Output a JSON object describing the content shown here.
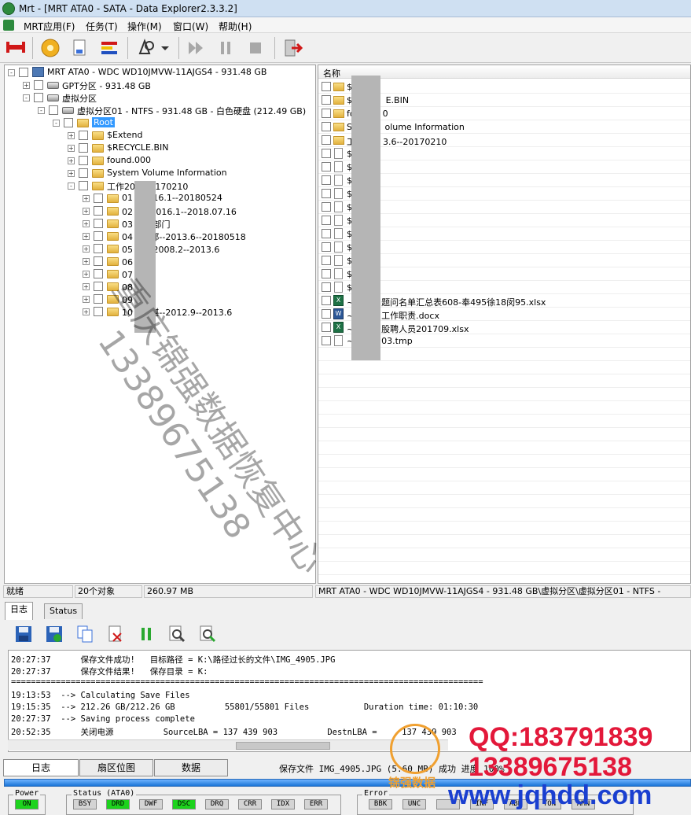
{
  "window": {
    "title": "Mrt - [MRT ATA0 - SATA - Data Explorer2.3.3.2]"
  },
  "menu": [
    "MRT应用(F)",
    "任务(T)",
    "操作(M)",
    "窗口(W)",
    "帮助(H)"
  ],
  "tree": [
    {
      "label": "MRT ATA0 - WDC WD10JMVW-11AJGS4 - 931.48 GB",
      "level": 0,
      "icon": "computer-icon",
      "expander": "-"
    },
    {
      "label": "GPT分区 - 931.48 GB",
      "level": 1,
      "icon": "disk-icon",
      "expander": "+"
    },
    {
      "label": "虚拟分区",
      "level": 1,
      "icon": "disk-icon",
      "expander": "-"
    },
    {
      "label": "虚拟分区01 - NTFS - 931.48 GB - 白色硬盘 (212.49 GB)",
      "level": 2,
      "icon": "disk-icon",
      "expander": "-"
    },
    {
      "label": "Root",
      "level": 3,
      "icon": "folder-icon",
      "expander": "-",
      "selected": true
    },
    {
      "label": "$Extend",
      "level": 4,
      "icon": "folder-icon",
      "expander": "+"
    },
    {
      "label": "$RECYCLE.BIN",
      "level": 4,
      "icon": "folder-icon",
      "expander": "+"
    },
    {
      "label": "found.000",
      "level": 4,
      "icon": "folder-icon",
      "expander": "+"
    },
    {
      "label": "System Volume Information",
      "level": 4,
      "icon": "folder-icon",
      "expander": "+"
    },
    {
      "label": "工作20     --20170210",
      "level": 4,
      "icon": "folder-icon",
      "expander": "-"
    },
    {
      "label": "01         --2016.1--20180524",
      "level": 5,
      "icon": "folder-icon",
      "expander": "+"
    },
    {
      "label": "02         会--2016.1--2018.07.16",
      "level": 5,
      "icon": "folder-icon",
      "expander": "+"
    },
    {
      "label": "03         职能部门",
      "level": 5,
      "icon": "folder-icon",
      "expander": "+"
    },
    {
      "label": "04         部--邵--2013.6--20180518",
      "level": 5,
      "icon": "folder-icon",
      "expander": "+"
    },
    {
      "label": "05         工作2008.2--2013.6",
      "level": 5,
      "icon": "folder-icon",
      "expander": "+"
    },
    {
      "label": "06         工作",
      "level": 5,
      "icon": "folder-icon",
      "expander": "+"
    },
    {
      "label": "07         工作",
      "level": 5,
      "icon": "folder-icon",
      "expander": "+"
    },
    {
      "label": "08         证书",
      "level": 5,
      "icon": "folder-icon",
      "expander": "+"
    },
    {
      "label": "09         申报",
      "level": 5,
      "icon": "folder-icon",
      "expander": "+"
    },
    {
      "label": "10         部--谌--2012.9--2013.6",
      "level": 5,
      "icon": "folder-icon",
      "expander": "+"
    }
  ],
  "files": {
    "header": "名称",
    "rows": [
      {
        "name": "$",
        "icon": "folder"
      },
      {
        "name": "$R          E.BIN",
        "icon": "folder"
      },
      {
        "name": "fo          0",
        "icon": "folder"
      },
      {
        "name": "Sy          olume Information",
        "icon": "folder"
      },
      {
        "name": "工          3.6--20170210",
        "icon": "folder"
      },
      {
        "name": "$A",
        "icon": "file"
      },
      {
        "name": "$B",
        "icon": "file"
      },
      {
        "name": "$B",
        "icon": "file"
      },
      {
        "name": "$E",
        "icon": "file"
      },
      {
        "name": "$L",
        "icon": "file"
      },
      {
        "name": "$N",
        "icon": "file"
      },
      {
        "name": "$N",
        "icon": "file"
      },
      {
        "name": "$S",
        "icon": "file"
      },
      {
        "name": "$U",
        "icon": "file"
      },
      {
        "name": "$V",
        "icon": "file"
      },
      {
        "name": "$V",
        "icon": "file"
      },
      {
        "name": "~          题问名单汇总表608-奉495徐18闵95.xlsx",
        "icon": "xls"
      },
      {
        "name": "~          工作职责.docx",
        "icon": "doc"
      },
      {
        "name": "~          股聘人员201709.xlsx",
        "icon": "xls"
      },
      {
        "name": "~          03.tmp",
        "icon": "file"
      }
    ]
  },
  "status": {
    "state": "就绪",
    "count": "20个对象",
    "size": "260.97 MB",
    "path": "MRT ATA0 - WDC WD10JMVW-11AJGS4 - 931.48 GB\\虚拟分区\\虚拟分区01 - NTFS -"
  },
  "log_tabs": [
    "日志",
    "Status"
  ],
  "log_lines": [
    "20:27:37      保存文件成功!   目标路径 = K:\\路径过长的文件\\IMG_4905.JPG",
    "20:27:37      保存文件结果!   保存目录 = K:",
    "===============================================================================================",
    "19:13:53  --> Calculating Save Files",
    "19:15:35  --> 212.26 GB/212.26 GB          55801/55801 Files           Duration time: 01:10:30",
    "20:27:37  --> Saving process complete",
    "20:52:35      关闭电源          SourceLBA = 137 439 903          DestnLBA =     137 439 903"
  ],
  "bottom_tabs": [
    "日志",
    "扇区位图",
    "数据"
  ],
  "save_status": "保存文件 IMG_4905.JPG (5.60 MB) 成功  进度 100%",
  "footer": {
    "power_title": "Power",
    "power": [
      {
        "label": "ON",
        "on": true
      }
    ],
    "status_title": "Status (ATA0)",
    "status_leds": [
      {
        "label": "BSY",
        "on": false
      },
      {
        "label": "DRD",
        "on": true
      },
      {
        "label": "DWF",
        "on": false
      },
      {
        "label": "DSC",
        "on": true
      },
      {
        "label": "DRQ",
        "on": false
      },
      {
        "label": "CRR",
        "on": false
      },
      {
        "label": "IDX",
        "on": false
      },
      {
        "label": "ERR",
        "on": false
      }
    ],
    "error_title": "Error",
    "error_leds": [
      {
        "label": "BBK",
        "on": false
      },
      {
        "label": "UNC",
        "on": false
      },
      {
        "label": "",
        "on": false
      },
      {
        "label": "INF",
        "on": false
      },
      {
        "label": "ABR",
        "on": false
      },
      {
        "label": "TON",
        "on": false
      },
      {
        "label": "AMN",
        "on": false
      }
    ]
  },
  "watermark": [
    "重庆锦强数据恢复中心",
    "13389675138"
  ],
  "brand": {
    "qq": "QQ:183791839",
    "phone": "13389675138",
    "url": "www.jqhdd.com",
    "name": "锦强数据"
  },
  "colors": {
    "selection": "#3399ff",
    "led_on": "#1dd31d",
    "brand_red": "#e3183a",
    "brand_blue": "#1a3fd0"
  }
}
